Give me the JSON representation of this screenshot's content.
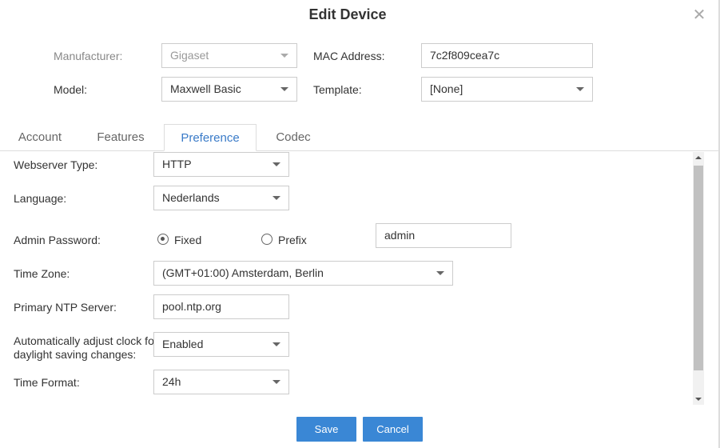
{
  "dialog": {
    "title": "Edit Device",
    "close_icon": "close-icon"
  },
  "device": {
    "manufacturer_label": "Manufacturer:",
    "manufacturer_value": "Gigaset",
    "mac_label": "MAC Address:",
    "mac_value": "7c2f809cea7c",
    "model_label": "Model:",
    "model_value": "Maxwell Basic",
    "template_label": "Template:",
    "template_value": "[None]"
  },
  "tabs": [
    {
      "label": "Account"
    },
    {
      "label": "Features"
    },
    {
      "label": "Preference",
      "active": true
    },
    {
      "label": "Codec"
    }
  ],
  "preference": {
    "webserver_type_label": "Webserver Type:",
    "webserver_type_value": "HTTP",
    "language_label": "Language:",
    "language_value": "Nederlands",
    "admin_password_label": "Admin Password:",
    "admin_password_options": [
      "Fixed",
      "Prefix"
    ],
    "admin_password_selected": "Fixed",
    "admin_password_value": "admin",
    "time_zone_label": "Time Zone:",
    "time_zone_value": "(GMT+01:00) Amsterdam, Berlin",
    "ntp_label": "Primary NTP Server:",
    "ntp_value": "pool.ntp.org",
    "dst_label_line1": "Automatically adjust clock for",
    "dst_label_line2": "daylight saving changes:",
    "dst_value": "Enabled",
    "time_format_label": "Time Format:",
    "time_format_value": "24h"
  },
  "footer": {
    "save_label": "Save",
    "cancel_label": "Cancel"
  },
  "colors": {
    "accent": "#3a87d5",
    "active_tab": "#3a7bc8",
    "border": "#cccccc"
  }
}
